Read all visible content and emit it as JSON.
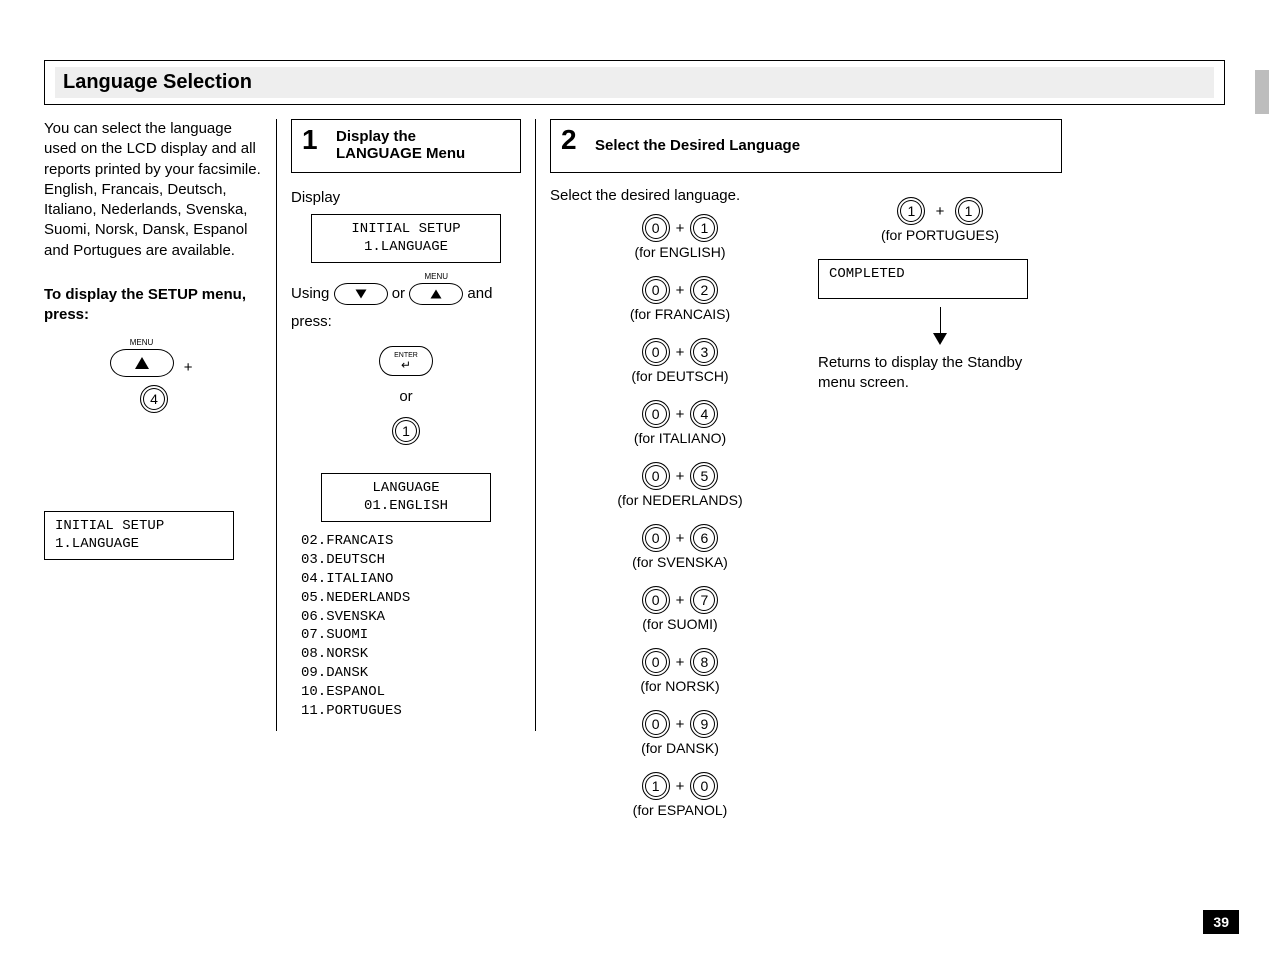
{
  "page_number": "39",
  "section_title": "Language   Selection",
  "intro": {
    "p1": "You can select the language used on the LCD display and all reports printed by your facsimile.   English, Francais, Deutsch, Italiano, Nederlands, Svenska, Suomi, Norsk, Dansk, Espanol and Portugues are available.",
    "p2_bold": "To display the SETUP menu, press:",
    "menu_label": "MENU",
    "plus": "+",
    "key4": "4",
    "lcd_intro": "INITIAL SETUP\n1.LANGUAGE"
  },
  "step1": {
    "num": "1",
    "title": "Display the\nLANGUAGE Menu",
    "display_label": "Display",
    "lcd1": "INITIAL SETUP\n1.LANGUAGE",
    "using_text_a": "Using",
    "using_text_b": " or ",
    "using_text_c": " and",
    "press_text": "press:",
    "or_text": "or",
    "enter_label": "ENTER",
    "key1": "1",
    "menu_label": "MENU",
    "lcd2": "LANGUAGE\n01.ENGLISH",
    "lang_list": "02.FRANCAIS\n03.DEUTSCH\n04.ITALIANO\n05.NEDERLANDS\n06.SVENSKA\n07.SUOMI\n08.NORSK\n09.DANSK\n10.ESPANOL\n11.PORTUGUES"
  },
  "step2": {
    "num": "2",
    "title": "Select the Desired Language",
    "instr": "Select the desired language.",
    "options_left": [
      {
        "k1": "0",
        "k2": "1",
        "label": "(for ENGLISH)"
      },
      {
        "k1": "0",
        "k2": "2",
        "label": "(for FRANCAIS)"
      },
      {
        "k1": "0",
        "k2": "3",
        "label": "(for DEUTSCH)"
      },
      {
        "k1": "0",
        "k2": "4",
        "label": "(for ITALIANO)"
      },
      {
        "k1": "0",
        "k2": "5",
        "label": "(for NEDERLANDS)"
      },
      {
        "k1": "0",
        "k2": "6",
        "label": "(for SVENSKA)"
      },
      {
        "k1": "0",
        "k2": "7",
        "label": "(for SUOMI)"
      },
      {
        "k1": "0",
        "k2": "8",
        "label": "(for NORSK)"
      },
      {
        "k1": "0",
        "k2": "9",
        "label": "(for DANSK)"
      },
      {
        "k1": "1",
        "k2": "0",
        "label": "(for ESPANOL)"
      }
    ],
    "option_right": {
      "k1": "1",
      "k2": "1",
      "label": "(for PORTUGUES)"
    },
    "completed": "COMPLETED",
    "return_text": "Returns to display the Standby menu screen."
  }
}
